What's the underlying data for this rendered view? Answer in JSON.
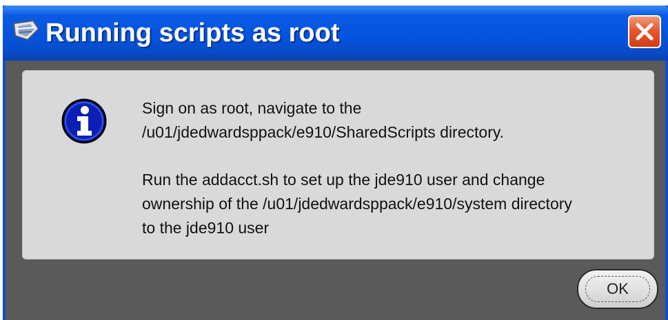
{
  "window": {
    "title": "Running scripts as root",
    "title_icon": "java-cup-icon",
    "close_icon": "close-icon"
  },
  "dialog": {
    "icon": "info-icon",
    "message_lines": [
      "Sign on as root, navigate to the",
      "/u01/jdedwardsppack/e910/SharedScripts directory.",
      "Run the addacct.sh to set up the jde910 user and change",
      "ownership of the /u01/jdedwardsppack/e910/system directory",
      "to the jde910 user"
    ],
    "ok_label": "OK"
  },
  "colors": {
    "titlebar": "#0454e0",
    "close_button": "#e8572e",
    "panel": "#d9d9d9",
    "background": "#5a5a5a",
    "info_icon": "#0a1fb5"
  }
}
